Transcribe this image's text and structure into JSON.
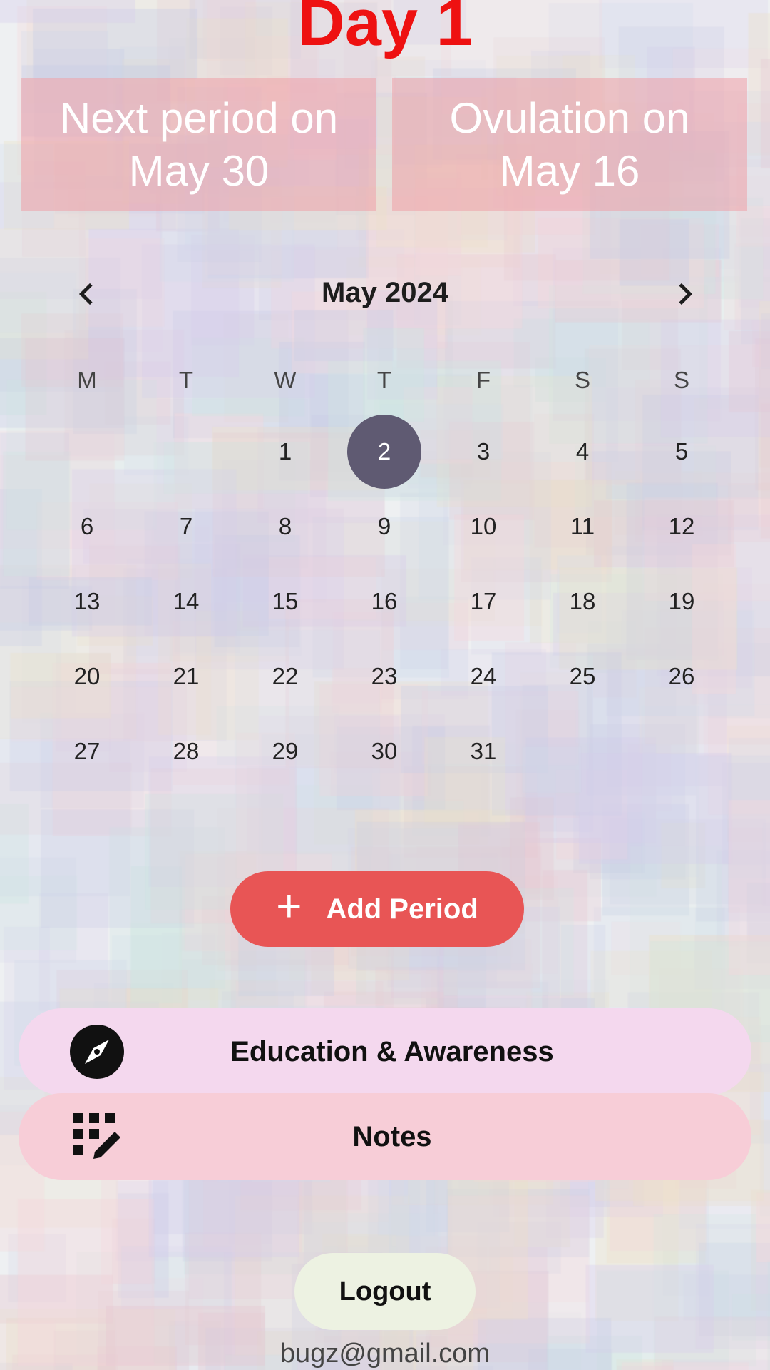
{
  "header": {
    "cycle_day": "Day 1"
  },
  "info_cards": {
    "next_period": {
      "line1": "Next period on",
      "line2": "May 30"
    },
    "ovulation": {
      "line1": "Ovulation on",
      "line2": "May 16"
    }
  },
  "calendar": {
    "month_label": "May 2024",
    "prev_icon": "chevron-left-icon",
    "next_icon": "chevron-right-icon",
    "weekdays": [
      "M",
      "T",
      "W",
      "T",
      "F",
      "S",
      "S"
    ],
    "first_day_column": 2,
    "days": [
      "1",
      "2",
      "3",
      "4",
      "5",
      "6",
      "7",
      "8",
      "9",
      "10",
      "11",
      "12",
      "13",
      "14",
      "15",
      "16",
      "17",
      "18",
      "19",
      "20",
      "21",
      "22",
      "23",
      "24",
      "25",
      "26",
      "27",
      "28",
      "29",
      "30",
      "31"
    ],
    "selected_day": "2",
    "selected_color": "#5f5a72"
  },
  "actions": {
    "add_period_label": "Add Period",
    "add_icon": "plus-icon",
    "accent_color": "#e85555"
  },
  "menu": {
    "education_label": "Education & Awareness",
    "education_icon": "compass-icon",
    "notes_label": "Notes",
    "notes_icon": "edit-grid-icon"
  },
  "account": {
    "logout_label": "Logout",
    "email": "bugz@gmail.com"
  }
}
